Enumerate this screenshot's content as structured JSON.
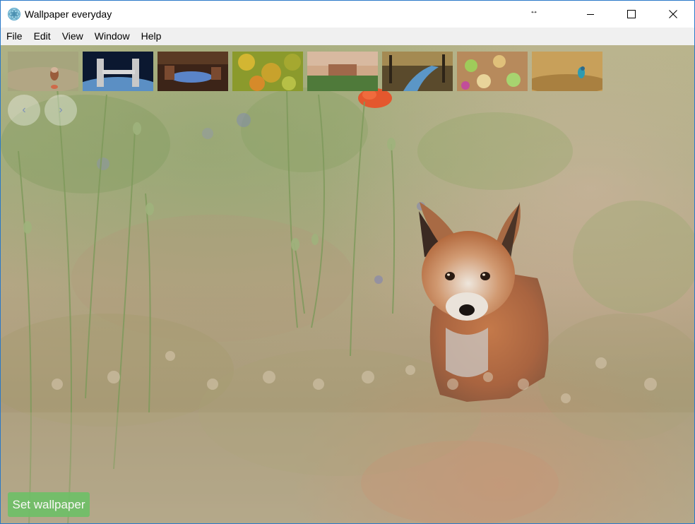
{
  "window": {
    "title": "Wallpaper everyday",
    "controls": {
      "minimize": "minimize-icon",
      "maximize": "maximize-icon",
      "close": "close-icon"
    }
  },
  "menu": {
    "items": [
      {
        "label": "File"
      },
      {
        "label": "Edit"
      },
      {
        "label": "View"
      },
      {
        "label": "Window"
      },
      {
        "label": "Help"
      }
    ]
  },
  "gallery": {
    "prev_label": "‹",
    "next_label": "›",
    "thumbnails_count": 8
  },
  "actions": {
    "set_wallpaper_label": "Set wallpaper"
  },
  "colors": {
    "window_border": "#2a79c8",
    "menubar_bg": "#f0f0f0",
    "button_green": "#6fbf68"
  }
}
